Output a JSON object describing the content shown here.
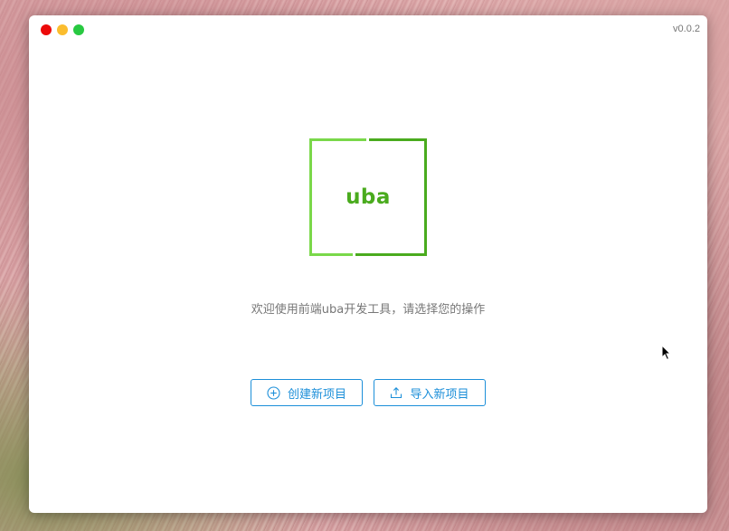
{
  "window": {
    "version": "v0.0.2",
    "traffic_lights": {
      "close": "#ec0a0a",
      "minimize": "#fbbd2e",
      "maximize": "#28c941"
    }
  },
  "logo": {
    "text": "uba",
    "colors": {
      "light": "#7ad84a",
      "dark": "#4aab1e"
    }
  },
  "welcome_text": "欢迎使用前端uba开发工具，请选择您的操作",
  "actions": {
    "create": {
      "label": "创建新项目",
      "icon": "plus-circle-icon"
    },
    "import": {
      "label": "导入新项目",
      "icon": "upload-icon"
    }
  },
  "accent_color": "#1c8fd9"
}
